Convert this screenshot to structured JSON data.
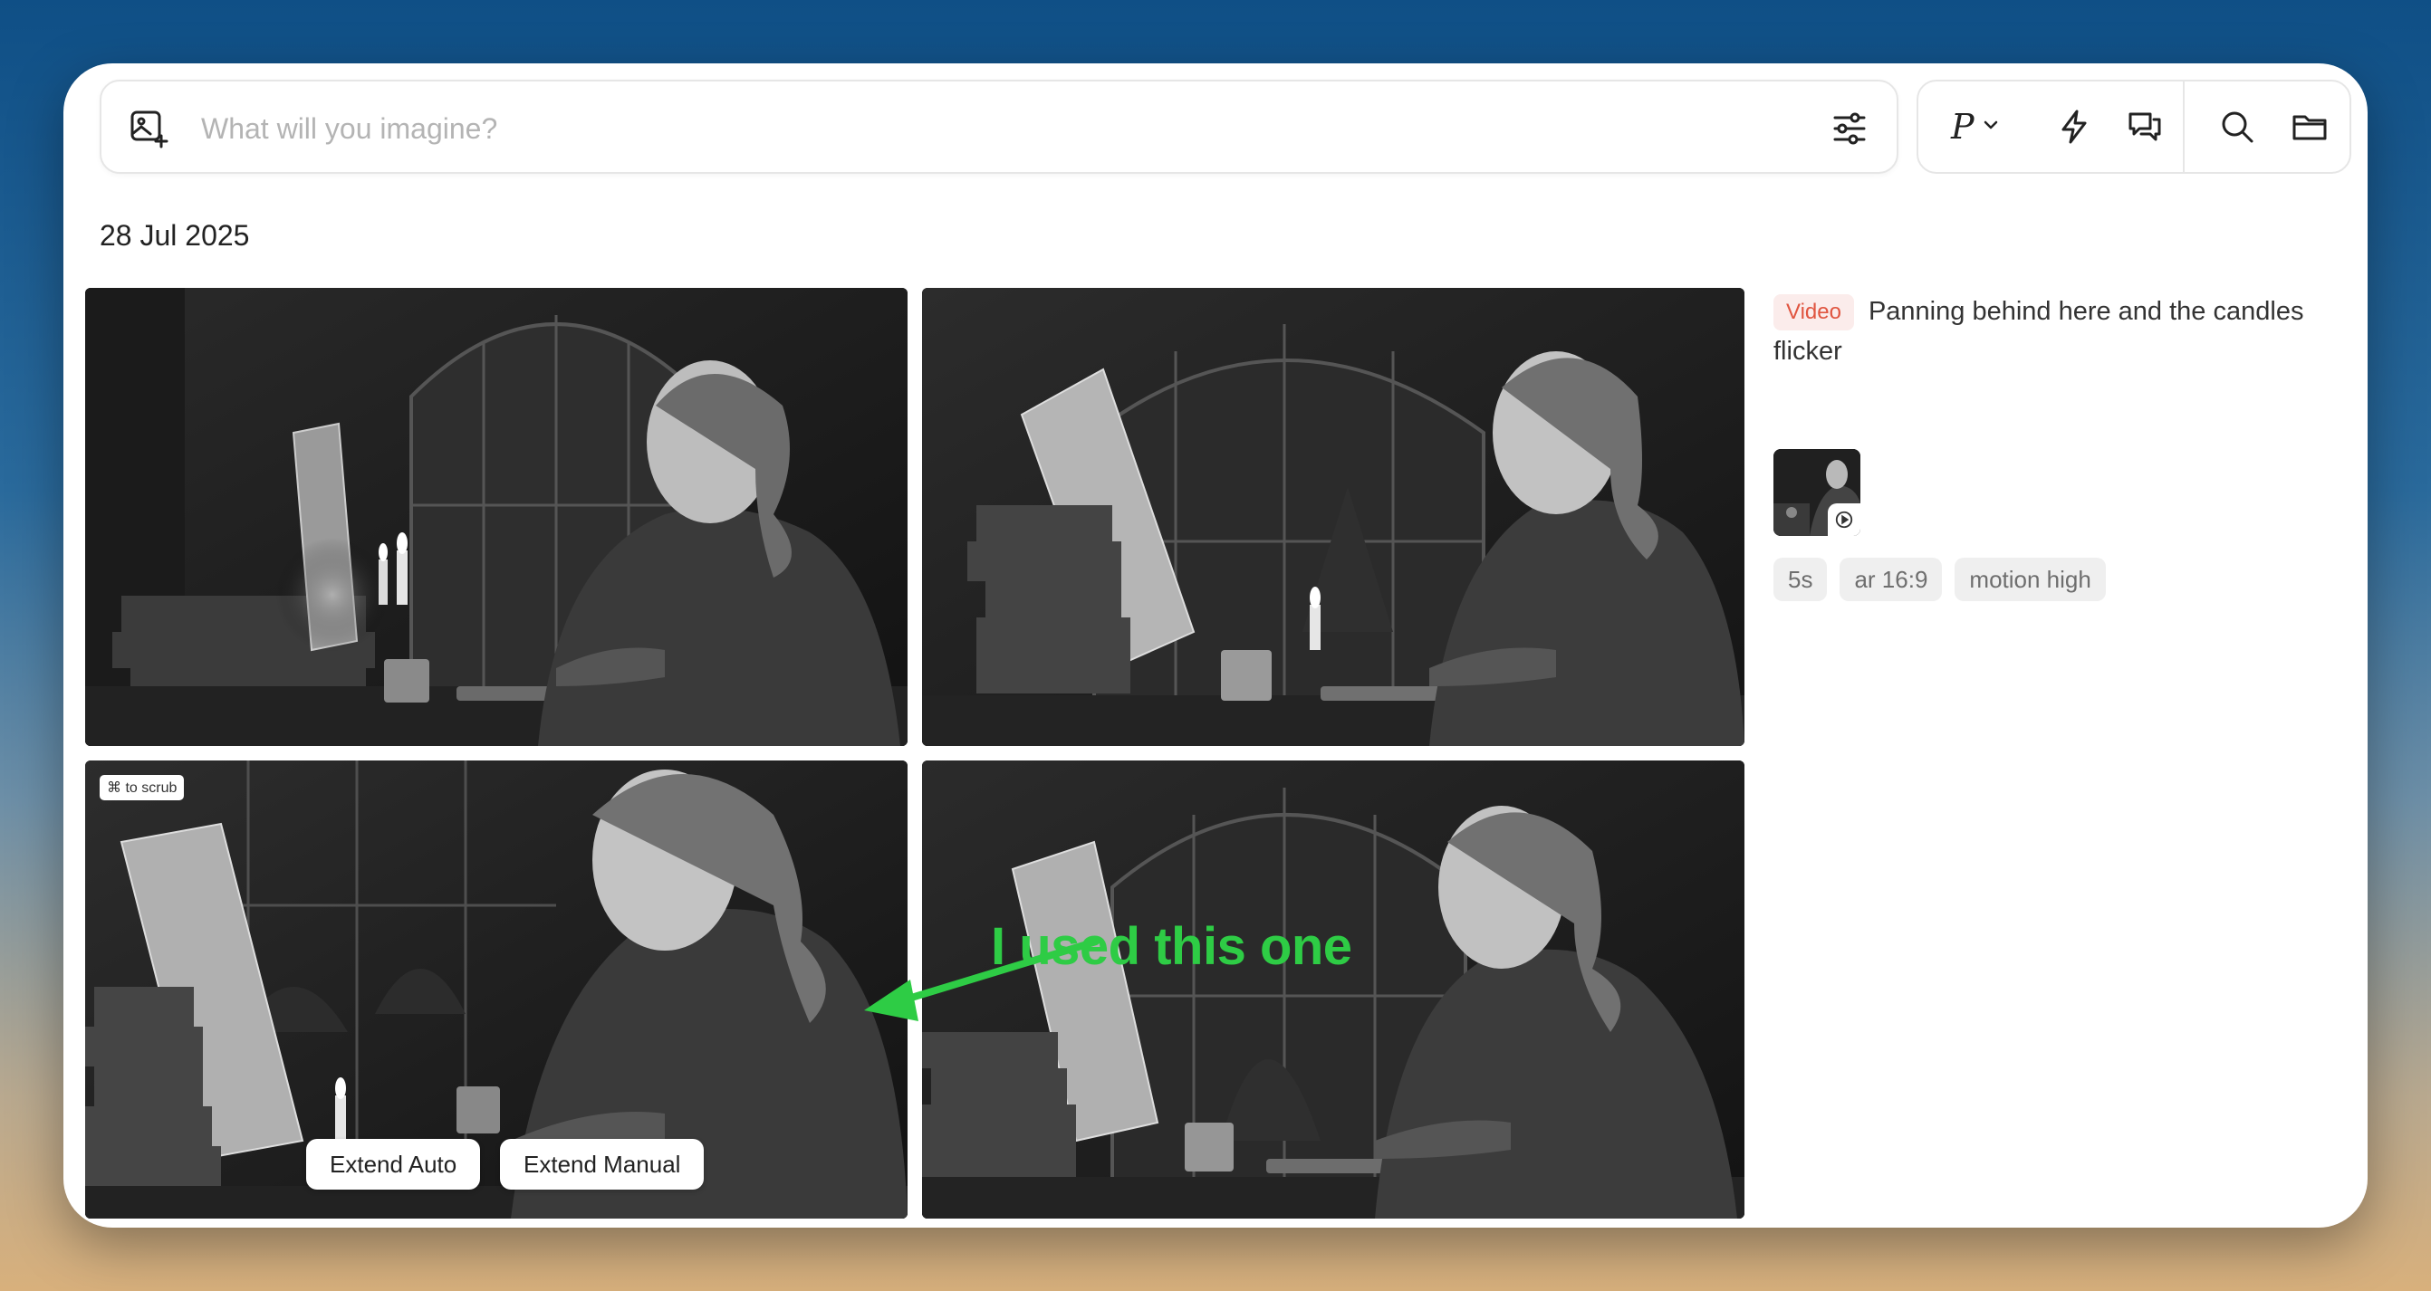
{
  "prompt_bar": {
    "placeholder": "What will you imagine?"
  },
  "toolbar": {
    "personalize_label": "P"
  },
  "date_label": "28 Jul 2025",
  "grid": {
    "badge": "⌘ to scrub",
    "extend_auto": "Extend Auto",
    "extend_manual": "Extend Manual",
    "annotation": "I used this one"
  },
  "job": {
    "type_tag": "Video",
    "prompt": "Panning behind here and the candles flicker",
    "params": [
      "5s",
      "ar 16:9",
      "motion high"
    ]
  },
  "colors": {
    "annotation": "#2ecc45",
    "video_tag": "#e05540"
  }
}
